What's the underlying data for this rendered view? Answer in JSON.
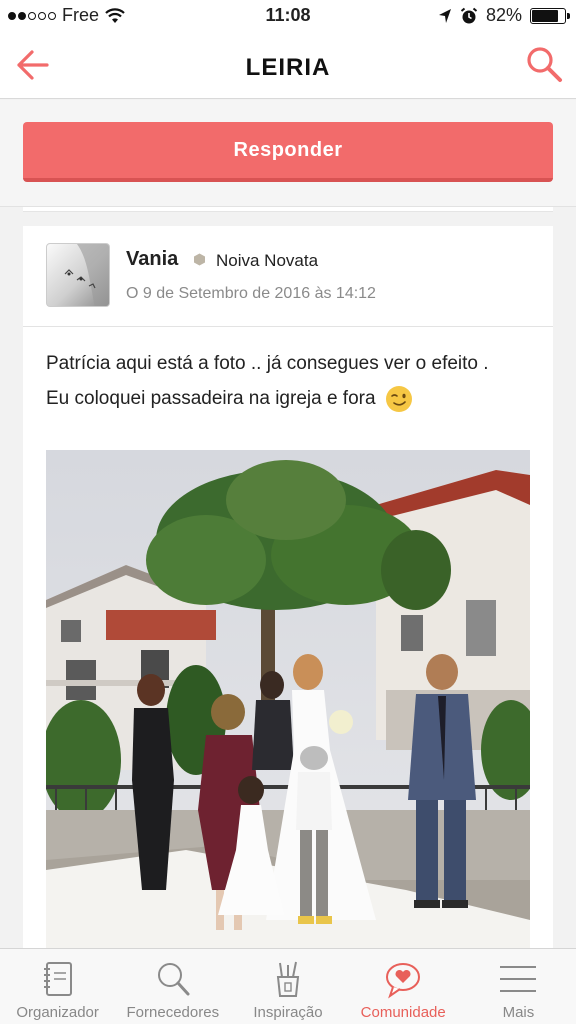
{
  "status_bar": {
    "carrier": "Free",
    "time": "11:08",
    "battery_percent": "82%",
    "battery_level": 0.82
  },
  "nav": {
    "title": "LEIRIA",
    "back_icon": "arrow-left-icon",
    "search_icon": "search-icon"
  },
  "reply": {
    "label": "Responder"
  },
  "post": {
    "author": "Vania",
    "rank": "Noiva Novata",
    "date": "O 9 de Setembro de 2016 às 14:12",
    "text_line1": "Patrícia aqui está a foto .. já consegues ver o efeito .",
    "text_line2": "Eu coloquei passadeira na igreja e fora",
    "emoji": "wink-emoji"
  },
  "tabs": [
    {
      "label": "Organizador",
      "icon": "notebook-icon",
      "active": false
    },
    {
      "label": "Fornecedores",
      "icon": "search-icon",
      "active": false
    },
    {
      "label": "Inspiração",
      "icon": "pencil-cup-icon",
      "active": false
    },
    {
      "label": "Comunidade",
      "icon": "heart-chat-icon",
      "active": true
    },
    {
      "label": "Mais",
      "icon": "menu-icon",
      "active": false
    }
  ],
  "colors": {
    "accent": "#f26b6b",
    "active_tab": "#e8605a",
    "muted_text": "#8a8a8a"
  }
}
